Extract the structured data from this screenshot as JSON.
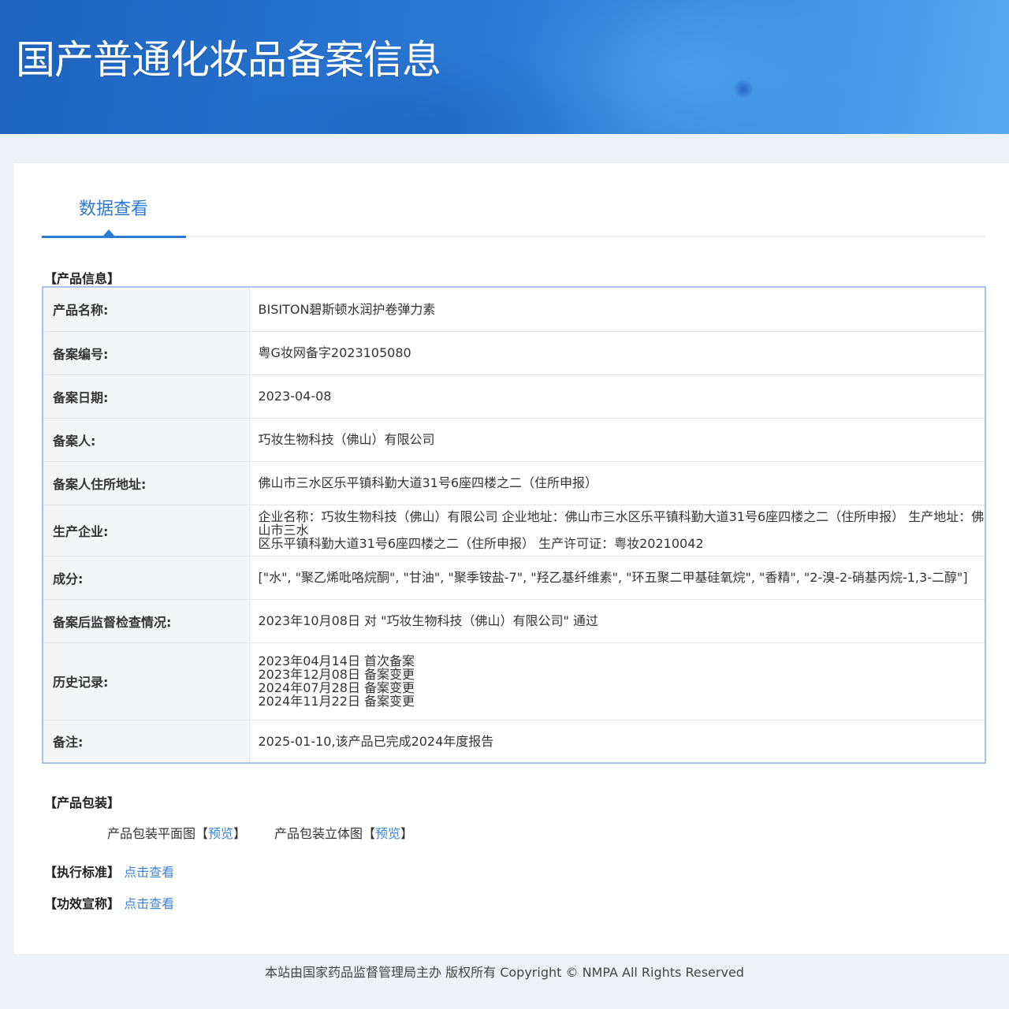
{
  "header": {
    "title": "国产普通化妆品备案信息"
  },
  "tab": {
    "label": "数据查看"
  },
  "sections": {
    "product_info": "【产品信息】",
    "product_package": "【产品包装】",
    "exec_standard": "【执行标准】",
    "efficacy_claim": "【功效宣称】"
  },
  "rows": [
    {
      "key": "产品名称:",
      "value": "BISITON碧斯顿水润护卷弹力素"
    },
    {
      "key": "备案编号:",
      "value": "粤G妆网备字2023105080"
    },
    {
      "key": "备案日期:",
      "value": "2023-04-08"
    },
    {
      "key": "备案人:",
      "value": "巧妆生物科技（佛山）有限公司"
    },
    {
      "key": "备案人住所地址:",
      "value": "佛山市三水区乐平镇科勤大道31号6座四楼之二（住所申报）"
    },
    {
      "key": "生产企业:",
      "lines": [
        "企业名称：巧妆生物科技（佛山）有限公司 企业地址：佛山市三水区乐平镇科勤大道31号6座四楼之二（住所申报） 生产地址：佛山市三水",
        "区乐平镇科勤大道31号6座四楼之二（住所申报） 生产许可证：粤妆20210042"
      ]
    },
    {
      "key": "成分:",
      "value": "[\"水\", \"聚乙烯吡咯烷酮\", \"甘油\", \"聚季铵盐-7\", \"羟乙基纤维素\", \"环五聚二甲基硅氧烷\", \"香精\", \"2-溴-2-硝基丙烷-1,3-二醇\"]"
    },
    {
      "key": "备案后监督检查情况:",
      "value": "2023年10月08日 对 \"巧妆生物科技（佛山）有限公司\" 通过"
    },
    {
      "key": "历史记录:",
      "lines": [
        "2023年04月14日 首次备案",
        "2023年12月08日 备案变更",
        "2024年07月28日 备案变更",
        "2024年11月22日 备案变更"
      ]
    },
    {
      "key": "备注:",
      "value": "2025-01-10,该产品已完成2024年度报告"
    }
  ],
  "package": {
    "flat_label": "产品包装平面图",
    "solid_label": "产品包装立体图",
    "preview": "预览",
    "bracket_open": "【",
    "bracket_close": "】"
  },
  "links": {
    "view": "点击查看"
  },
  "footer": {
    "text": "本站由国家药品监督管理局主办 版权所有 Copyright © NMPA All Rights Reserved"
  },
  "colors": {
    "banner": "#2a77d4",
    "accent": "#2d7ad6",
    "link": "#3d86d8"
  }
}
